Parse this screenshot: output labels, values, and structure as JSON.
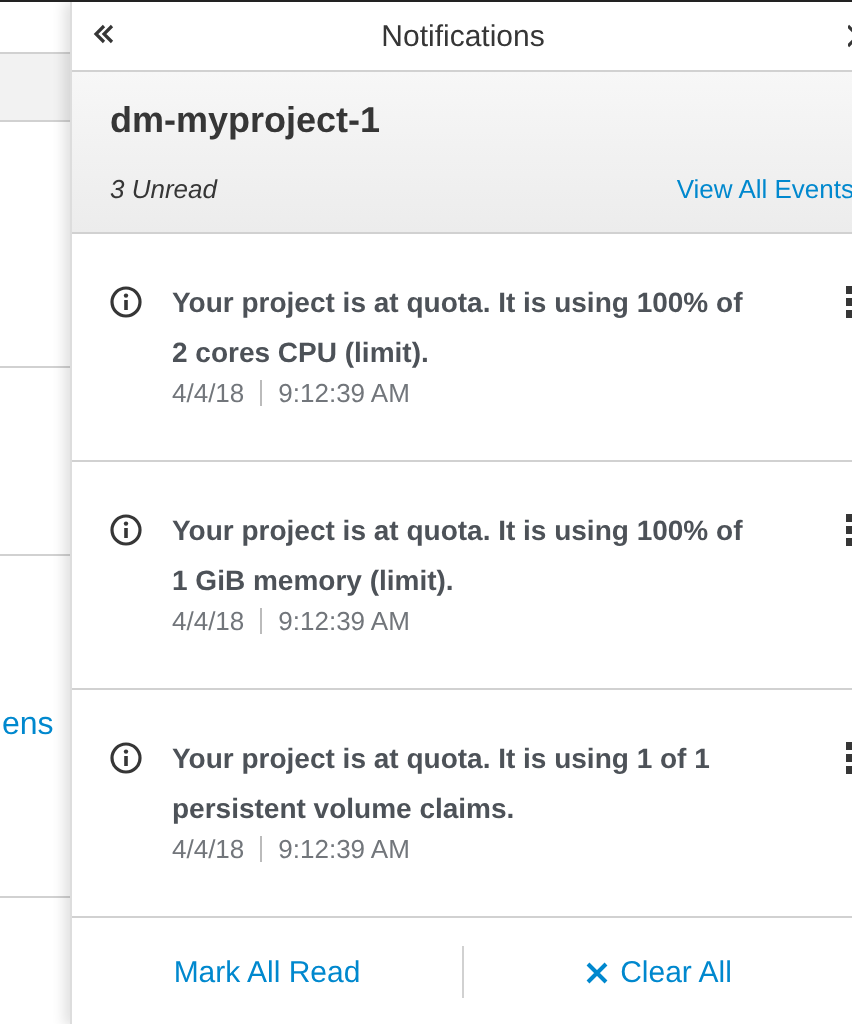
{
  "background": {
    "link": "ens"
  },
  "drawer": {
    "title": "Notifications",
    "project": "dm-myproject-1",
    "unread": "3 Unread",
    "view_all": "View All Events",
    "notifications": [
      {
        "message": "Your project is at quota. It is using 100% of 2 cores CPU (limit).",
        "date": "4/4/18",
        "time": "9:12:39 AM"
      },
      {
        "message": "Your project is at quota. It is using 100% of 1 GiB memory (limit).",
        "date": "4/4/18",
        "time": "9:12:39 AM"
      },
      {
        "message": "Your project is at quota. It is using 1 of 1 persistent volume claims.",
        "date": "4/4/18",
        "time": "9:12:39 AM"
      }
    ],
    "actions": {
      "mark_all": "Mark All Read",
      "clear_all": "Clear All"
    }
  }
}
